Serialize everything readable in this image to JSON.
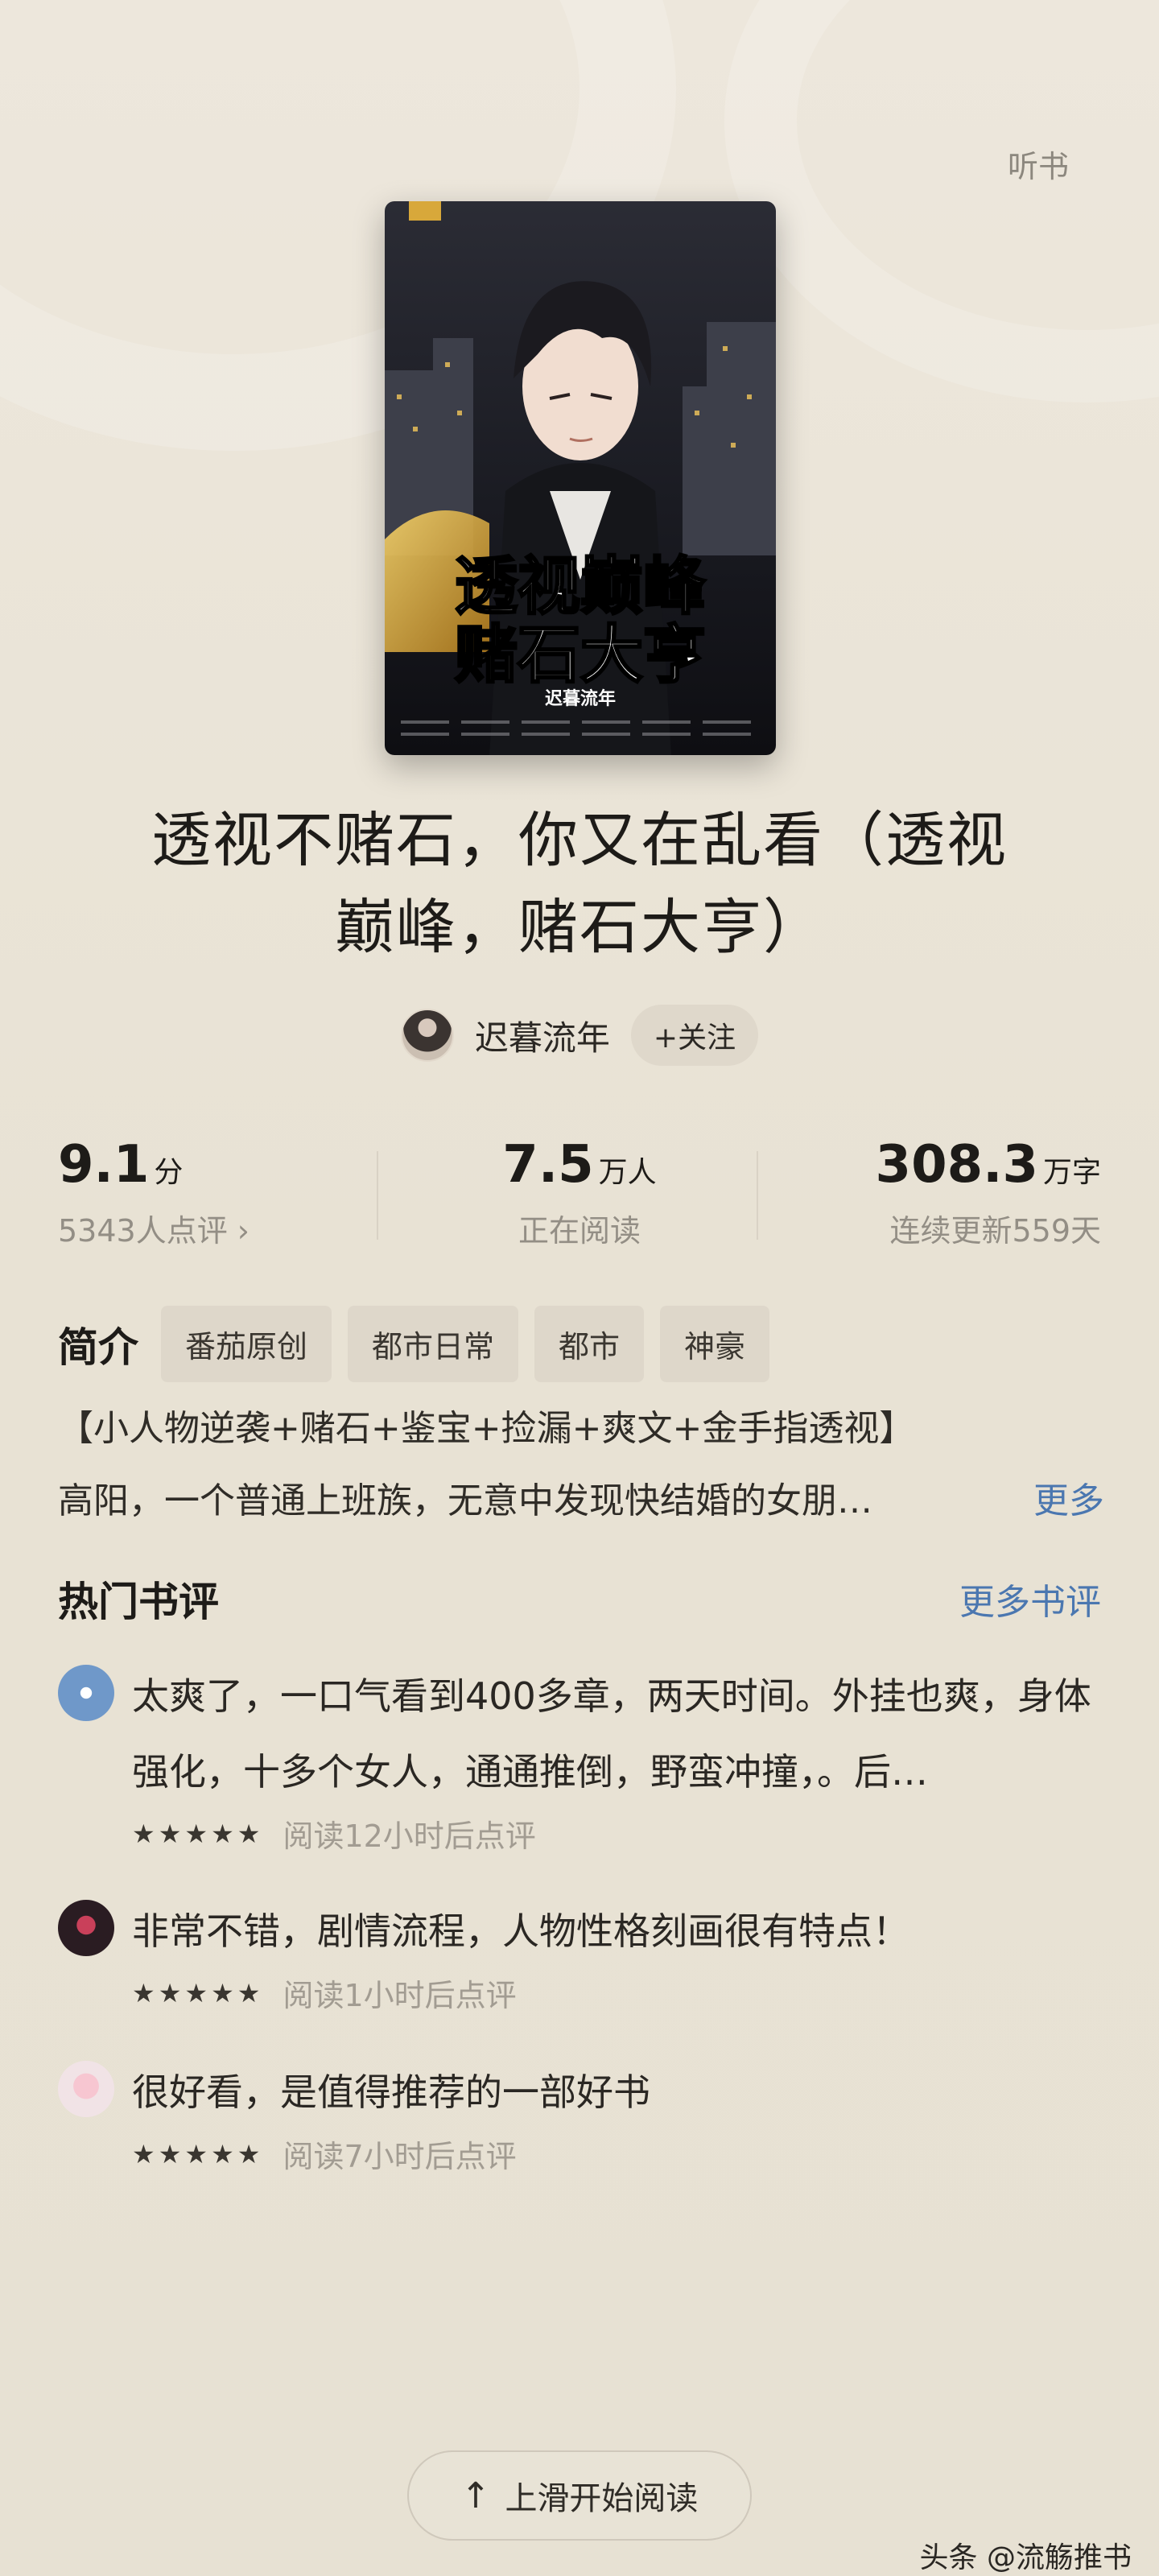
{
  "header": {
    "listen_label": "听书"
  },
  "book": {
    "cover_title_line1": "透视巅峰",
    "cover_title_line2": "赌石大亨",
    "cover_author": "迟暮流年",
    "title": "透视不赌石，你又在乱看（透视巅峰，赌石大亨）"
  },
  "author": {
    "name": "迟暮流年",
    "follow_label": "+关注"
  },
  "stats": {
    "score": "9.1",
    "score_unit": "分",
    "score_sub": "5343人点评 ›",
    "readers": "7.5",
    "readers_unit": "万人",
    "readers_sub": "正在阅读",
    "words": "308.3",
    "words_unit": "万字",
    "words_sub": "连续更新559天"
  },
  "intro": {
    "label": "简介",
    "tags": [
      "番茄原创",
      "都市日常",
      "都市",
      "神豪"
    ],
    "line1": "【小人物逆袭+赌石+鉴宝+捡漏+爽文+金手指透视】",
    "line2": "高阳，一个普通上班族，无意中发现快结婚的女朋…",
    "more_label": "更多"
  },
  "reviews": {
    "title": "热门书评",
    "more_label": "更多书评",
    "items": [
      {
        "text": "太爽了，一口气看到400多章，两天时间。外挂也爽，身体强化，十多个女人，通通推倒，野蛮冲撞，。后…",
        "stars": "★★★★★",
        "time": "阅读12小时后点评"
      },
      {
        "text": "非常不错，剧情流程，人物性格刻画很有特点！",
        "stars": "★★★★★",
        "time": "阅读1小时后点评"
      },
      {
        "text": "很好看，是值得推荐的一部好书",
        "stars": "★★★★★",
        "time": "阅读7小时后点评"
      }
    ]
  },
  "footer": {
    "start_reading_label": "上滑开始阅读",
    "watermark": "头条 @流觞推书"
  },
  "colors": {
    "background": "#e9e3d6",
    "link": "#4b77b0",
    "text": "#1d1b18",
    "muted": "#938e85"
  }
}
